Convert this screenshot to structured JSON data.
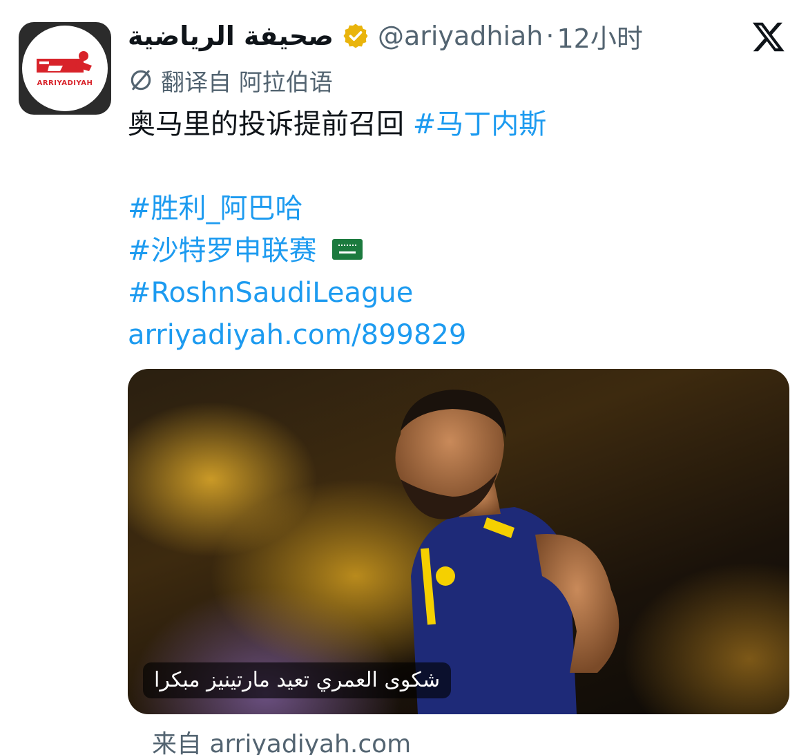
{
  "author": {
    "display_name": "صحيفة الرياضية",
    "handle": "@ariyadhiah",
    "separator": "·",
    "time_ago": "12小时",
    "verified": true,
    "verified_color": "#e9b40c",
    "avatar_logo_text": "ARRIYADIYAH",
    "avatar_brand_color": "#d8232a"
  },
  "translation": {
    "label": "翻译自 阿拉伯语"
  },
  "tweet": {
    "main_text": "奥马里的投诉提前召回",
    "main_hashtag": "#马丁内斯",
    "hashtag_1": "#胜利_阿巴哈",
    "hashtag_2": "#沙特罗申联赛",
    "hashtag_3": "#RoshnSaudiLeague",
    "link": "arriyadiyah.com/899829"
  },
  "link_card": {
    "caption": "شكوى العمري تعيد مارتينيز مبكرا",
    "image_alt_text": "شكوى العمري تعيد مارتينيز مبكرا"
  },
  "source": {
    "label": "来自 arriyadiyah.com"
  },
  "colors": {
    "link": "#1d9bf0",
    "secondary_text": "#536471",
    "primary_text": "#0f1419"
  }
}
